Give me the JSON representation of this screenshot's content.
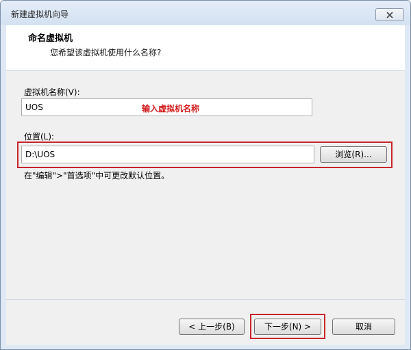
{
  "window": {
    "title": "新建虚拟机向导"
  },
  "header": {
    "title": "命名虚拟机",
    "subtitle": "您希望该虚拟机使用什么名称?"
  },
  "form": {
    "name_label": "虚拟机名称(V):",
    "name_value": "UOS",
    "name_annotation": "输入虚拟机名称",
    "location_label": "位置(L):",
    "location_value": "D:\\UOS",
    "browse_label": "浏览(R)...",
    "hint": "在\"编辑\">\"首选项\"中可更改默认位置。"
  },
  "footer": {
    "back_label": "< 上一步(B)",
    "next_label": "下一步(N) >",
    "cancel_label": "取消"
  },
  "colors": {
    "annotation": "#d21a1a",
    "highlight_frame": "#c8262c"
  }
}
